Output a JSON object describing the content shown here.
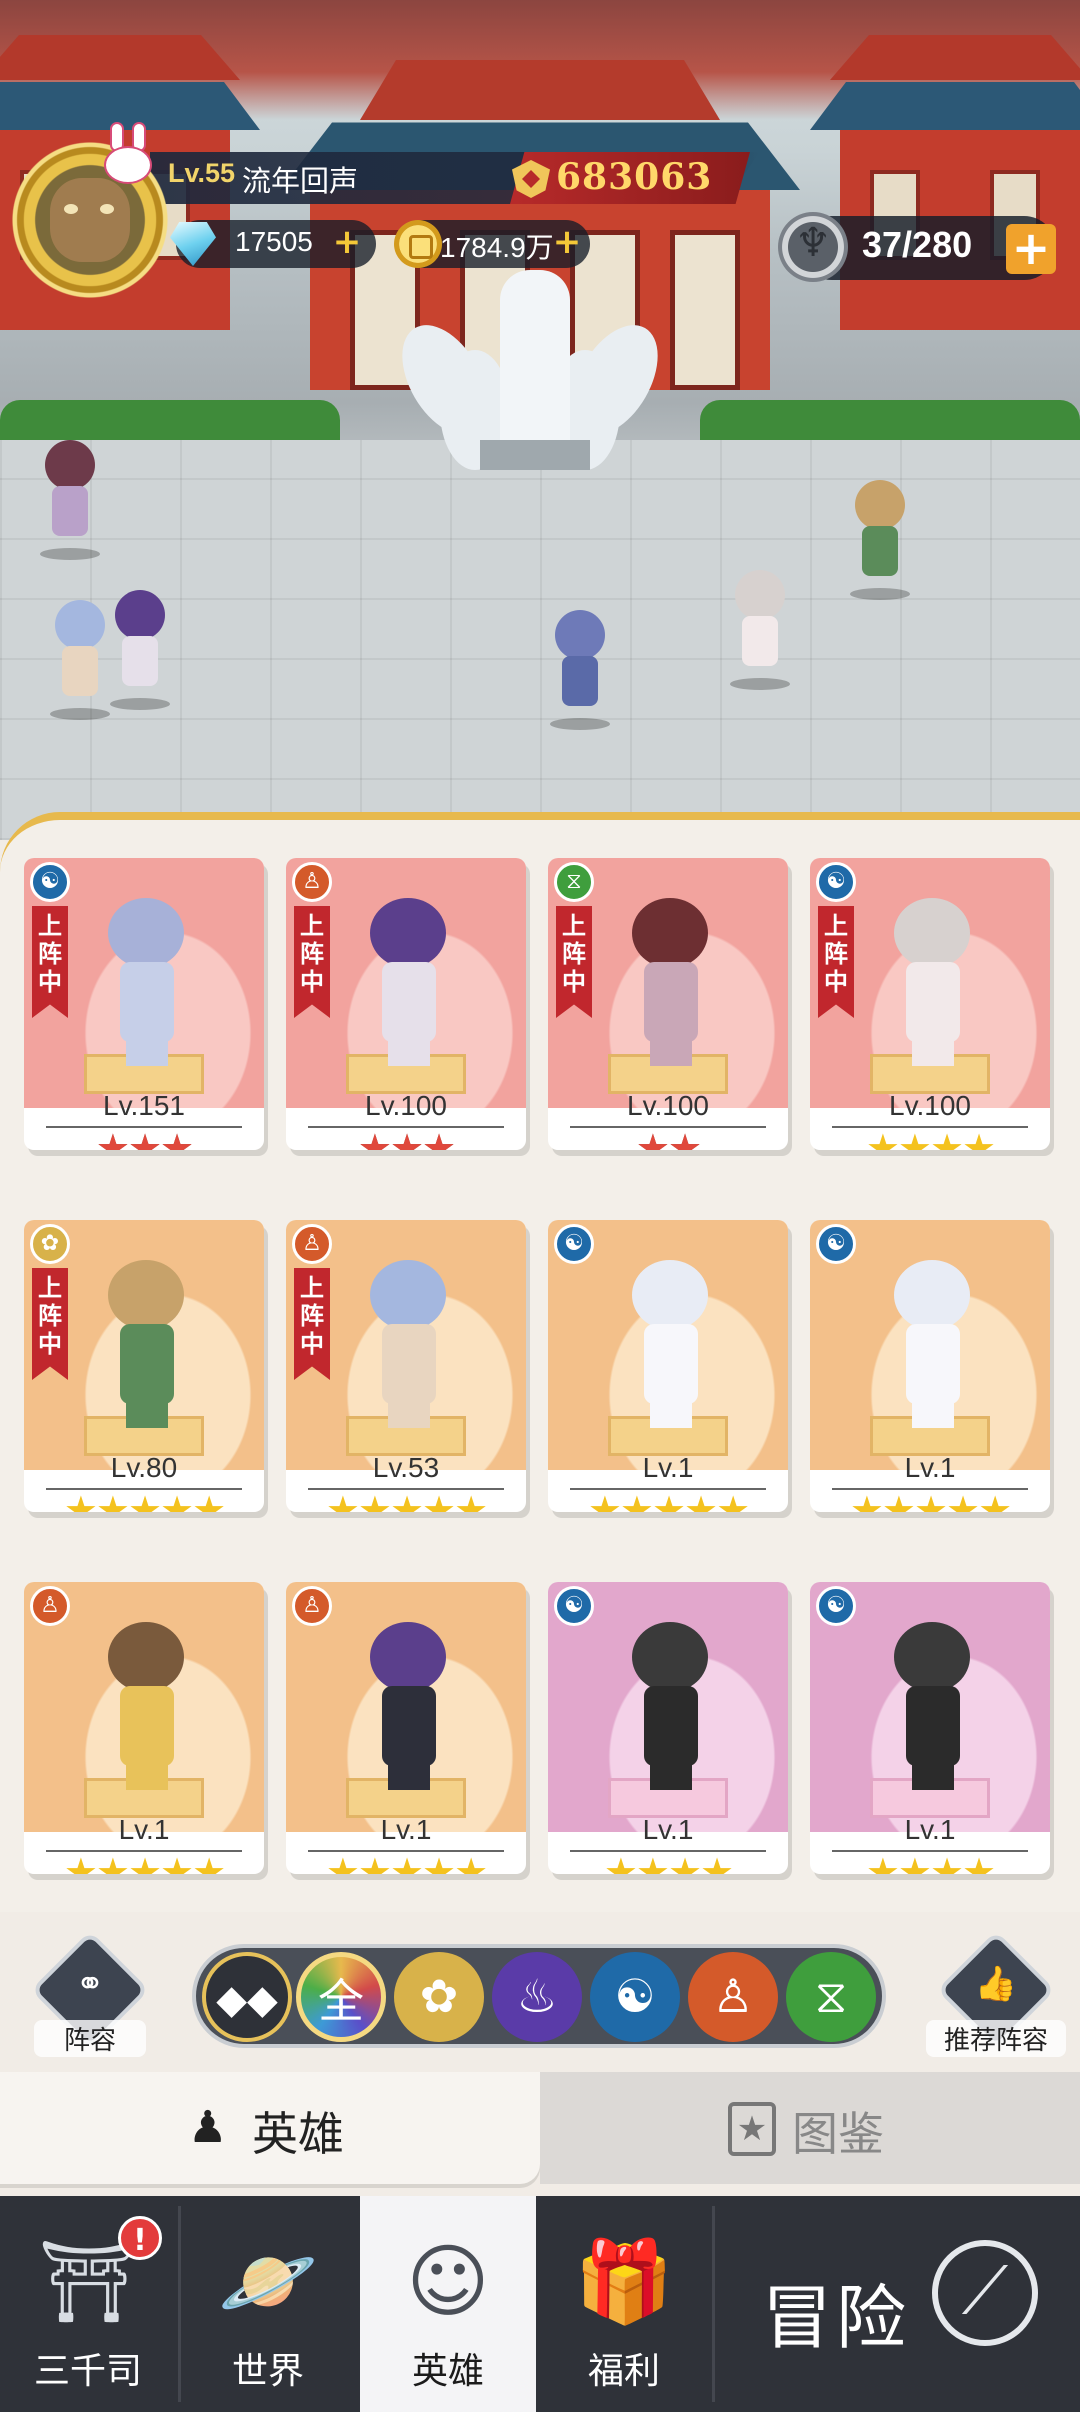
{
  "player": {
    "level": "Lv.55",
    "name": "流年回声",
    "power": "683063",
    "gems": "17505",
    "gold": "1784.9万",
    "stamina": "37/280",
    "plus": "+"
  },
  "heroes": [
    {
      "level": "Lv.151",
      "stars": 3,
      "star_color": "red",
      "bg": "red",
      "deployed": true,
      "faction": "water-swirl-icon"
    },
    {
      "level": "Lv.100",
      "stars": 3,
      "star_color": "red",
      "bg": "red",
      "deployed": true,
      "faction": "meditation-icon"
    },
    {
      "level": "Lv.100",
      "stars": 2,
      "star_color": "red",
      "bg": "red",
      "deployed": true,
      "faction": "dna-icon"
    },
    {
      "level": "Lv.100",
      "stars": 4,
      "star_color": "gold",
      "bg": "red",
      "deployed": true,
      "faction": "water-swirl-icon"
    },
    {
      "level": "Lv.80",
      "stars": 5,
      "star_color": "gold",
      "bg": "gold",
      "deployed": true,
      "faction": "lotus-icon"
    },
    {
      "level": "Lv.53",
      "stars": 5,
      "star_color": "gold",
      "bg": "gold",
      "deployed": true,
      "faction": "meditation-icon"
    },
    {
      "level": "Lv.1",
      "stars": 5,
      "star_color": "gold",
      "bg": "gold",
      "deployed": false,
      "faction": "water-swirl-icon"
    },
    {
      "level": "Lv.1",
      "stars": 5,
      "star_color": "gold",
      "bg": "gold",
      "deployed": false,
      "faction": "water-swirl-icon"
    },
    {
      "level": "Lv.1",
      "stars": 5,
      "star_color": "gold",
      "bg": "gold",
      "deployed": false,
      "faction": "meditation-icon"
    },
    {
      "level": "Lv.1",
      "stars": 5,
      "star_color": "gold",
      "bg": "gold",
      "deployed": false,
      "faction": "meditation-icon"
    },
    {
      "level": "Lv.1",
      "stars": 4,
      "star_color": "gold",
      "bg": "pink",
      "deployed": false,
      "faction": "water-swirl-icon"
    },
    {
      "level": "Lv.1",
      "stars": 4,
      "star_color": "gold",
      "bg": "pink",
      "deployed": false,
      "faction": "water-swirl-icon"
    }
  ],
  "deploy_label": "上阵中",
  "filter": {
    "lineup_label": "阵容",
    "recommend_label": "推荐阵容",
    "all_label": "全",
    "buttons": [
      "diamond-tiles-icon",
      "all-icon",
      "lotus-icon",
      "flame-icon",
      "water-swirl-icon",
      "meditation-icon",
      "dna-icon"
    ]
  },
  "tabs": {
    "hero": "英雄",
    "codex": "图鉴"
  },
  "nav": {
    "items": [
      "三千司",
      "世界",
      "英雄",
      "福利"
    ],
    "adventure": "冒险",
    "badge": "!"
  },
  "colors": {
    "accent": "#e7b94d",
    "deploy_ribbon": "#c1272d",
    "power": "#ffd86a"
  }
}
